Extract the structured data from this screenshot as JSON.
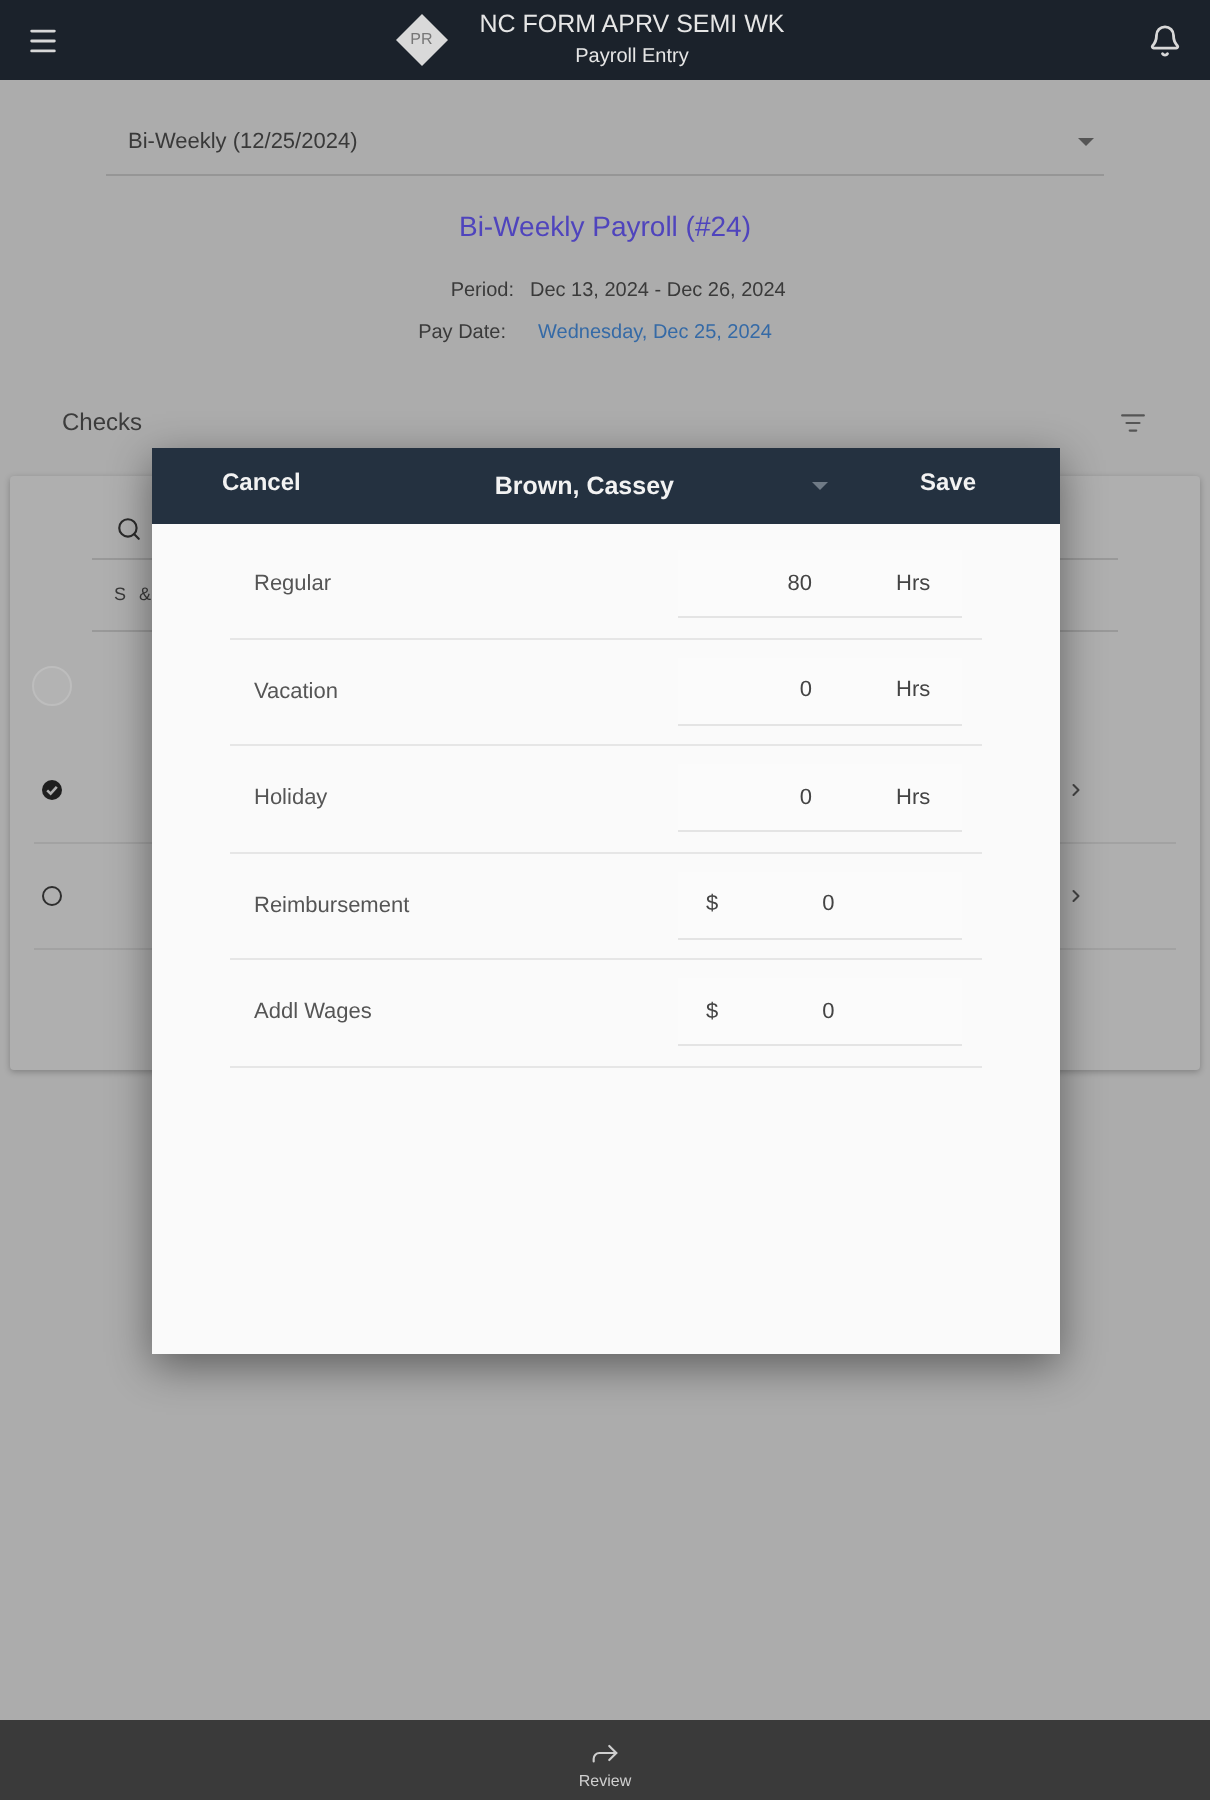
{
  "header": {
    "title": "NC FORM APRV SEMI WK",
    "subtitle": "Payroll Entry",
    "logo_text": "PR"
  },
  "pay_period_select": {
    "value": "Bi-Weekly (12/25/2024)"
  },
  "payroll_title": "Bi-Weekly Payroll (#24)",
  "details": [
    {
      "label": "Period:",
      "value": "Dec 13, 2024 - Dec 26, 2024",
      "kind": "text"
    },
    {
      "label": "Pay Date:",
      "value": "Wednesday, Dec 25, 2024",
      "kind": "link"
    }
  ],
  "checks": {
    "title": "Checks",
    "column_header": "S &",
    "rows": [
      {
        "kind": "select_all",
        "checked": false
      },
      {
        "kind": "employee",
        "checked": true
      },
      {
        "kind": "employee",
        "checked": false
      }
    ]
  },
  "dialog": {
    "cancel": "Cancel",
    "employee": "Brown, Cassey",
    "save": "Save",
    "entries": [
      {
        "label": "Regular",
        "kind": "hours",
        "value": "80",
        "unit": "Hrs"
      },
      {
        "label": "Vacation",
        "kind": "hours",
        "value": "0",
        "unit": "Hrs"
      },
      {
        "label": "Holiday",
        "kind": "hours",
        "value": "0",
        "unit": "Hrs"
      },
      {
        "label": "Reimbursement",
        "kind": "amount",
        "prefix": "$",
        "value": "0"
      },
      {
        "label": "Addl Wages",
        "kind": "amount",
        "prefix": "$",
        "value": "0"
      }
    ]
  },
  "bottom_bar": {
    "actions": [
      {
        "label": "Review"
      }
    ]
  }
}
